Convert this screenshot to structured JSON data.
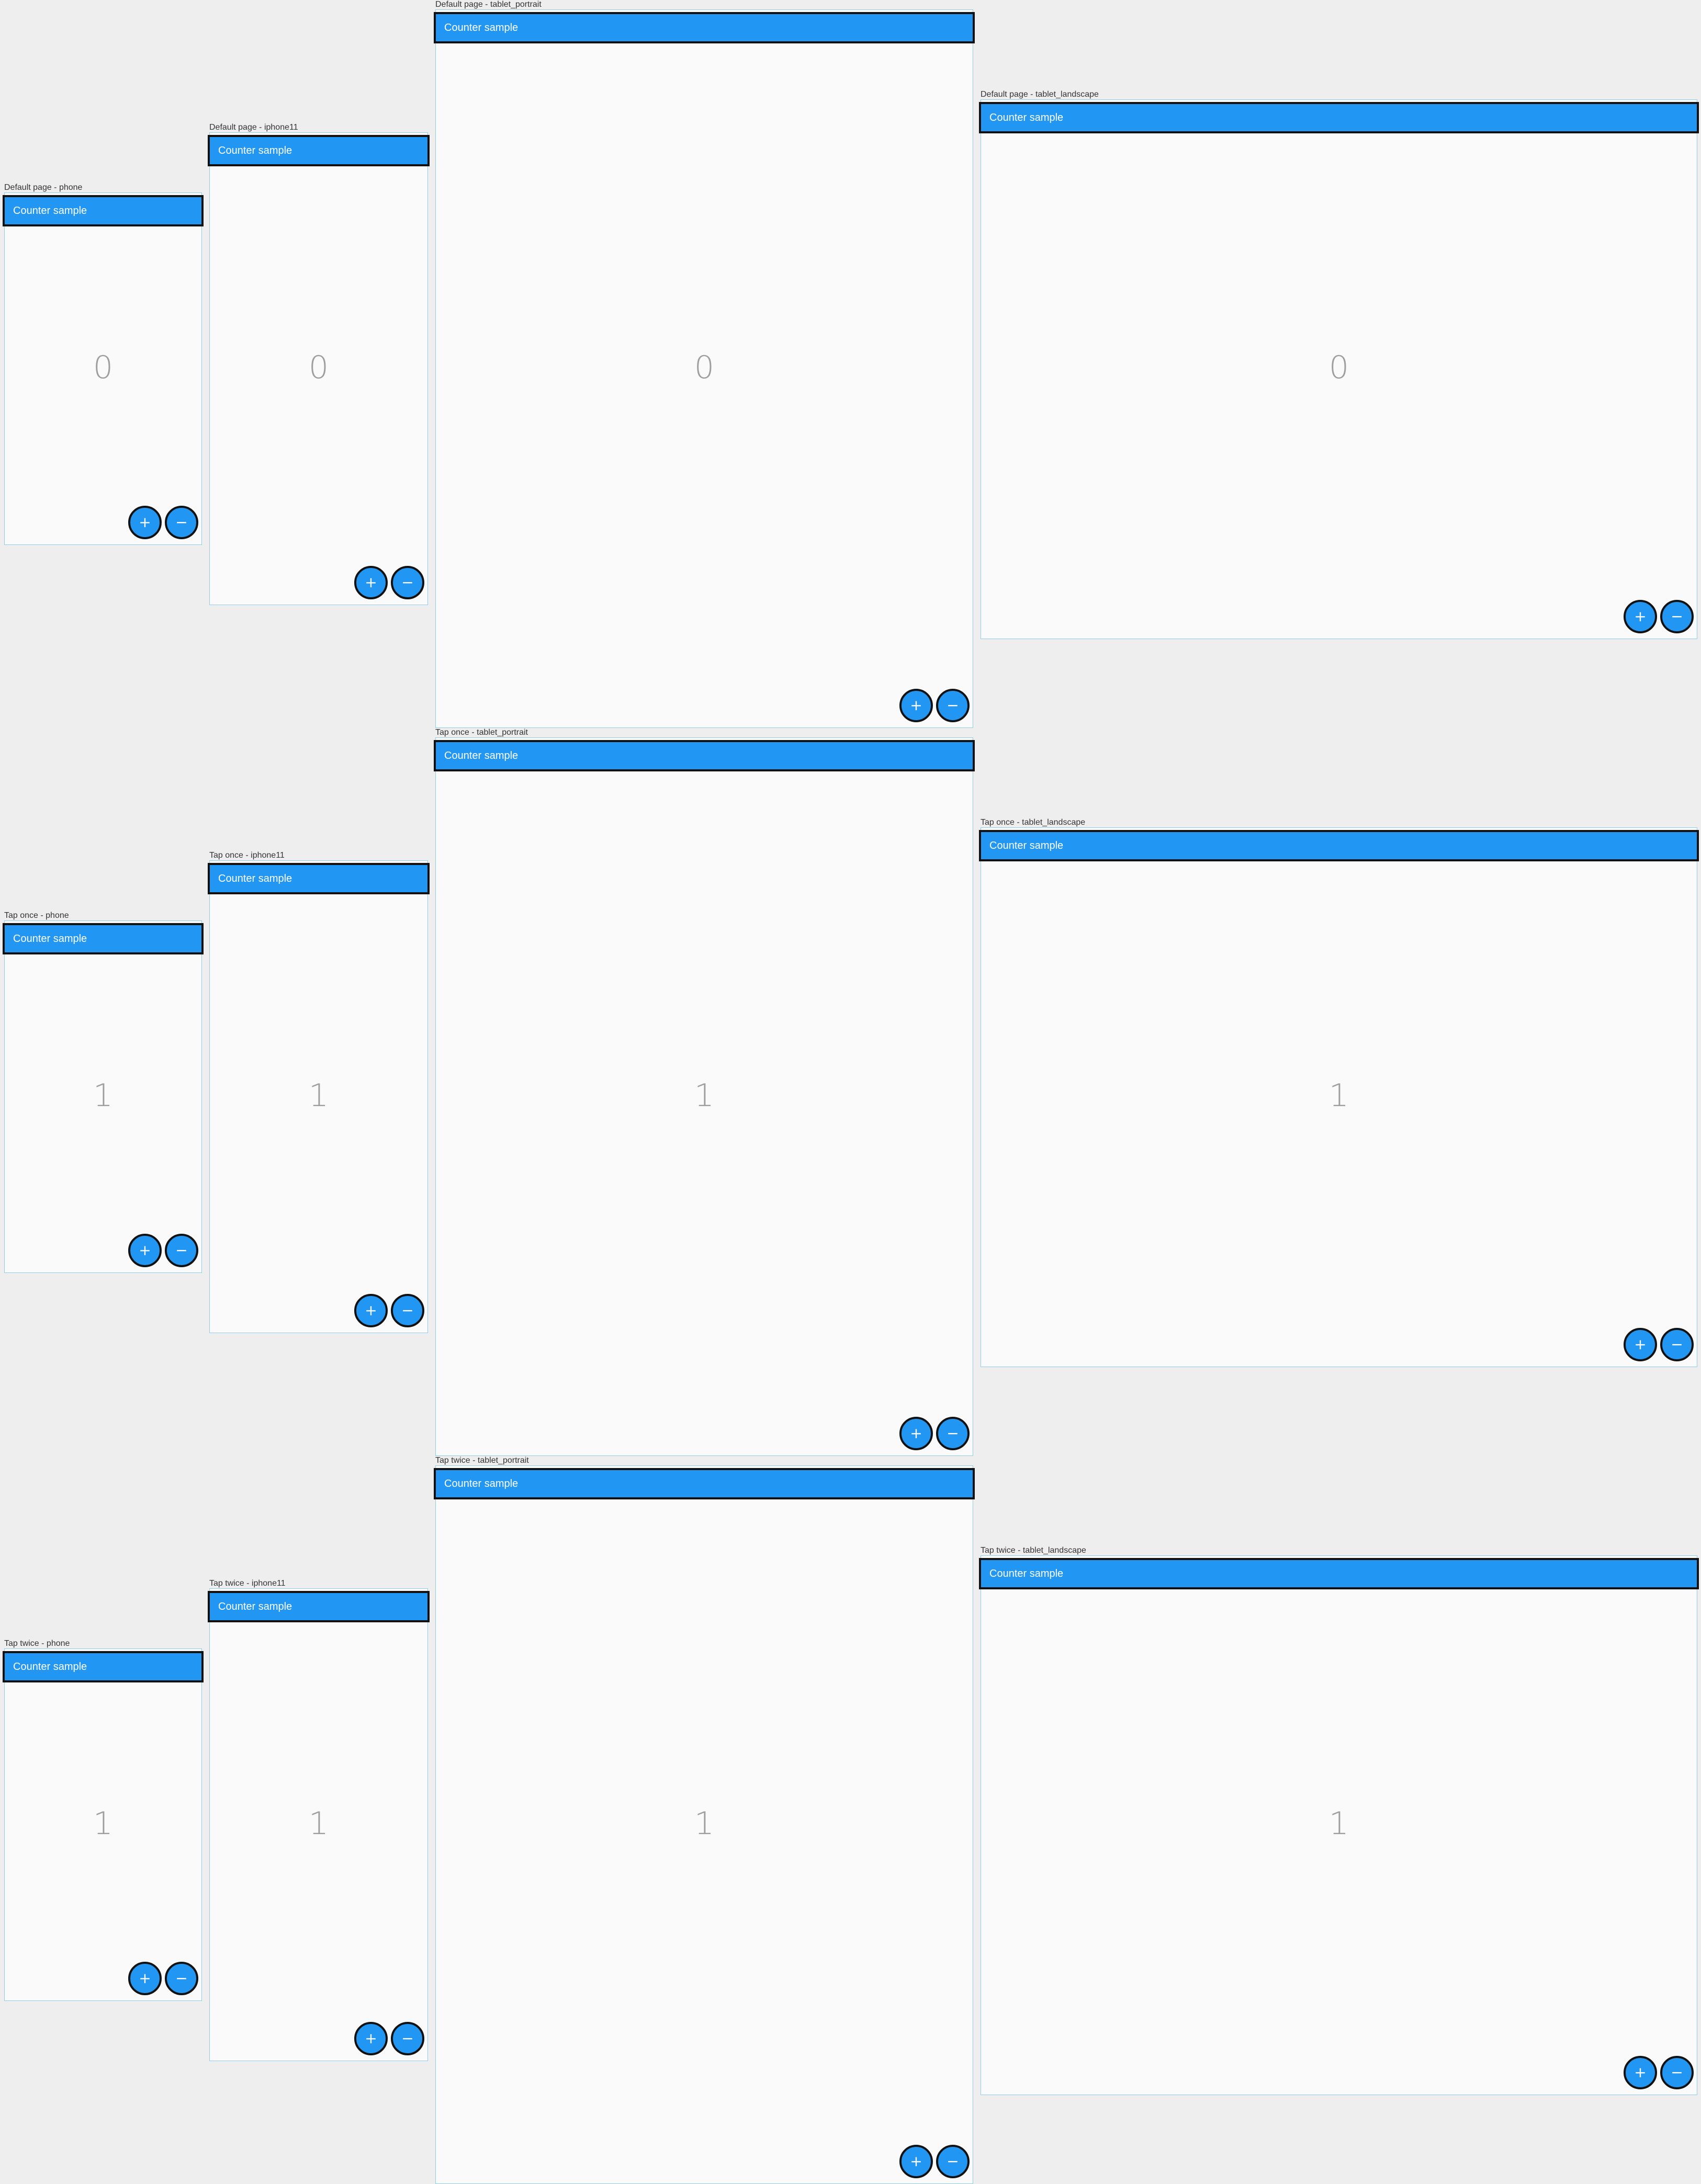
{
  "app_bar_title": "Counter sample",
  "increment_symbol": "+",
  "decrement_symbol": "−",
  "colors": {
    "primary": "#2196f3",
    "background": "#eeeeee",
    "surface": "#fafafa",
    "counter_text": "#9e9e9e"
  },
  "scenarios": [
    {
      "label_phone": "Default page - phone",
      "label_iphone11": "Default page - iphone11",
      "label_tablet_portrait": "Default page - tablet_portrait",
      "label_tablet_landscape": "Default page - tablet_landscape",
      "counter": "0"
    },
    {
      "label_phone": "Tap once - phone",
      "label_iphone11": "Tap once - iphone11",
      "label_tablet_portrait": "Tap once - tablet_portrait",
      "label_tablet_landscape": "Tap once - tablet_landscape",
      "counter": "1"
    },
    {
      "label_phone": "Tap twice - phone",
      "label_iphone11": "Tap twice - iphone11",
      "label_tablet_portrait": "Tap twice - tablet_portrait",
      "label_tablet_landscape": "Tap twice - tablet_landscape",
      "counter": "1"
    }
  ]
}
